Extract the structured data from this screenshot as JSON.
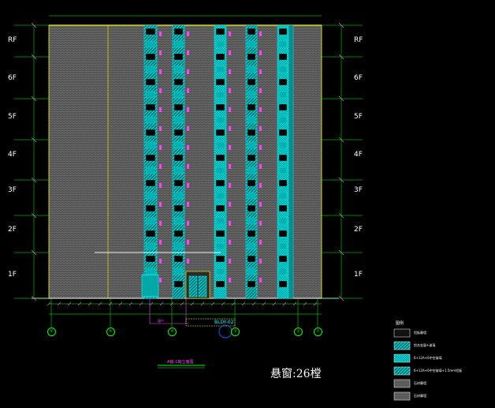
{
  "floors_left": [
    "RF",
    "6F",
    "5F",
    "4F",
    "3F",
    "2F",
    "1F"
  ],
  "floors_right": [
    "RF",
    "6F",
    "5F",
    "4F",
    "3F",
    "2F",
    "1F"
  ],
  "grid_bubbles": [
    "⑥",
    "⑤",
    "④",
    "③",
    "②",
    "①"
  ],
  "tag": "BLDY-02",
  "pointer_label": "窗户",
  "view_title": "A轴-1轴立面图",
  "sheet_title": "悬窗:26樘",
  "legend": {
    "title": "图例",
    "items": [
      "铝板幕墙",
      "铝合金窗+玻璃",
      "6+12A+6中空玻璃",
      "6+12A+6中空玻璃+1.5mm铝板",
      "石材幕墙",
      "石材幕墙"
    ]
  },
  "colors": {
    "cyan": "#00e5e5",
    "magenta": "#ff40ff",
    "yellow": "#ffff00",
    "green": "#00ff00",
    "hatch": "#9a9a9a"
  }
}
